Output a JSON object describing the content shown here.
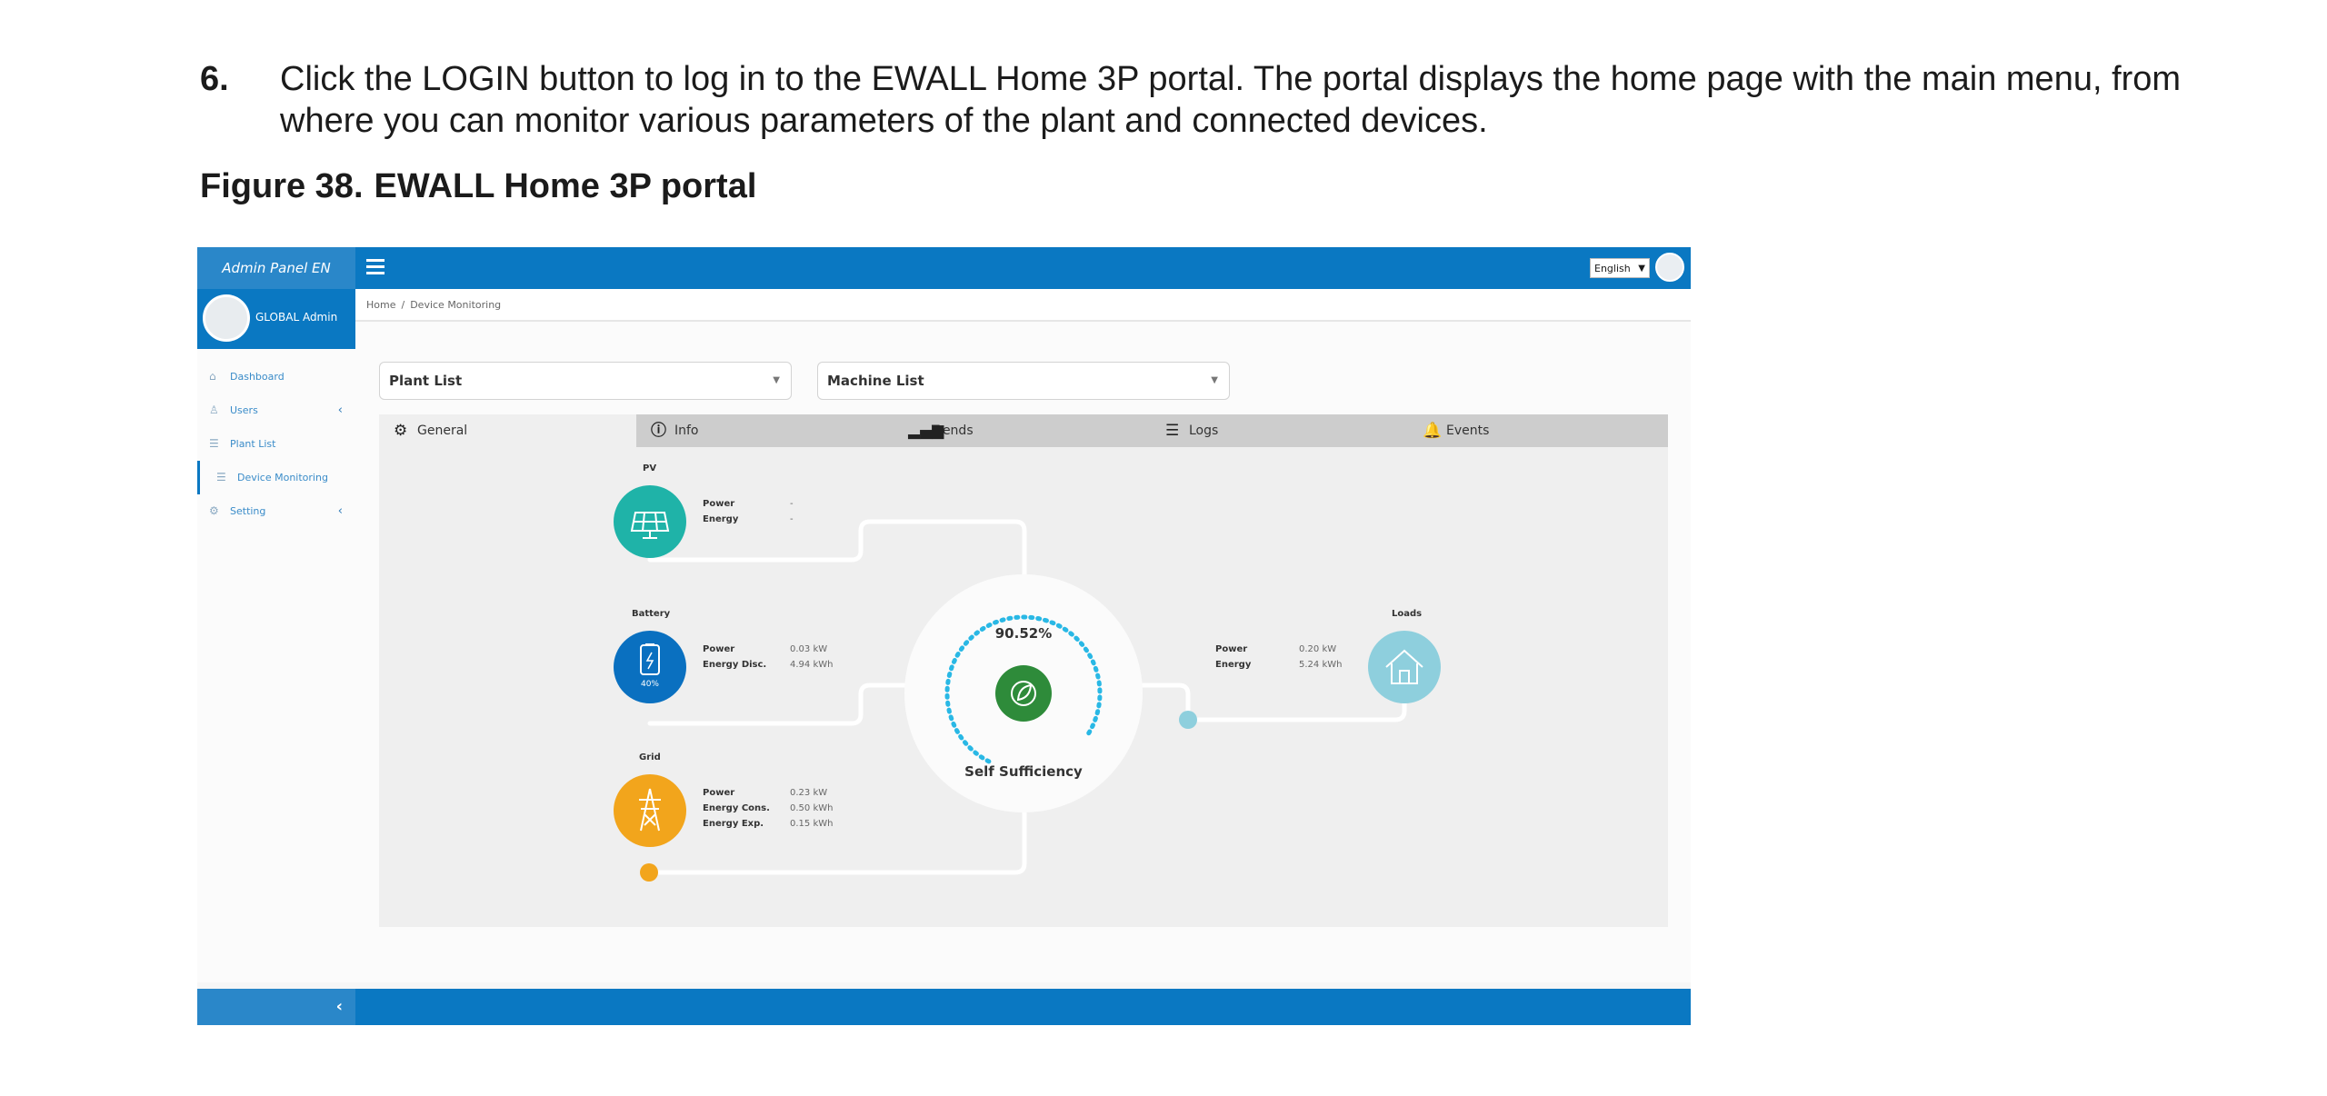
{
  "document": {
    "step_number": "6.",
    "step_text": "Click the LOGIN button to log in to the EWALL Home 3P portal. The portal displays the home page with the main menu, from where you can monitor various parameters of the plant and connected devices.",
    "figure_label": "Figure 38.",
    "figure_title": "EWALL Home 3P portal"
  },
  "app": {
    "panel_title": "Admin Panel EN",
    "language": "English",
    "user_name": "GLOBAL Admin",
    "accent_color": "#0a78c2"
  },
  "sidebar": {
    "items": [
      {
        "label": "Dashboard",
        "icon": "home-icon"
      },
      {
        "label": "Users",
        "icon": "users-icon"
      },
      {
        "label": "Plant List",
        "icon": "list-icon"
      },
      {
        "label": "Device Monitoring",
        "icon": "list-icon"
      },
      {
        "label": "Setting",
        "icon": "gear-icon"
      }
    ]
  },
  "breadcrumb": {
    "home": "Home",
    "separator": "/",
    "current": "Device Monitoring"
  },
  "filters": {
    "plant_list": "Plant List",
    "machine_list": "Machine List"
  },
  "tabs": [
    {
      "label": "General",
      "icon": "gear-icon"
    },
    {
      "label": "Info",
      "icon": "info-icon"
    },
    {
      "label": "Trends",
      "icon": "signal-bars-icon"
    },
    {
      "label": "Logs",
      "icon": "list-icon"
    },
    {
      "label": "Events",
      "icon": "bell-icon"
    }
  ],
  "diagram": {
    "pv": {
      "title": "PV",
      "power_label": "Power",
      "power_value": "-",
      "energy_label": "Energy",
      "energy_value": "-",
      "color": "#1fb3a8"
    },
    "battery": {
      "title": "Battery",
      "power_label": "Power",
      "power_value": "0.03 kW",
      "energy_label": "Energy Disc.",
      "energy_value": "4.94 kWh",
      "soc": "40%",
      "color": "#0a70c0"
    },
    "grid": {
      "title": "Grid",
      "power_label": "Power",
      "power_value": "0.23 kW",
      "cons_label": "Energy Cons.",
      "cons_value": "0.50 kWh",
      "exp_label": "Energy Exp.",
      "exp_value": "0.15 kWh",
      "color": "#f2a51c"
    },
    "loads": {
      "title": "Loads",
      "power_label": "Power",
      "power_value": "0.20 kW",
      "energy_label": "Energy",
      "energy_value": "5.24 kWh",
      "color": "#8ecfdd"
    },
    "self_sufficiency": {
      "percent": "90.52%",
      "percent_fraction": 0.9052,
      "label": "Self Sufficiency",
      "color": "#2e8b3a"
    }
  }
}
